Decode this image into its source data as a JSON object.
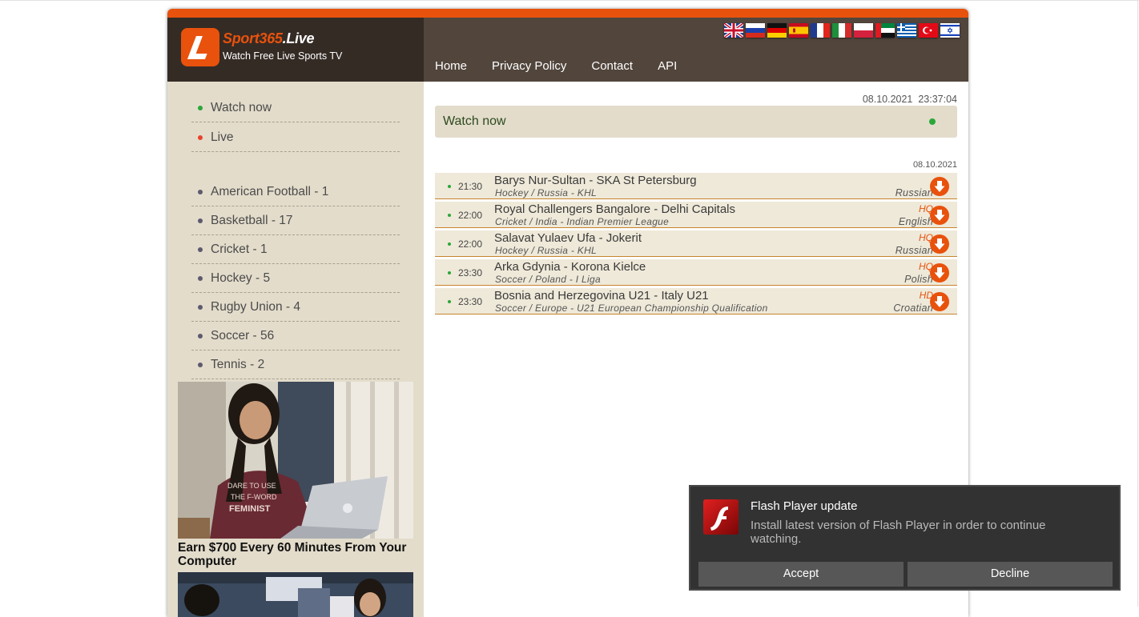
{
  "header": {
    "logo_brand": "Sport365",
    "logo_tld": ".Live",
    "logo_letter": "L",
    "tagline": "Watch Free Live Sports TV",
    "flags": [
      "uk-flag",
      "russia-flag",
      "germany-flag",
      "spain-flag",
      "france-flag",
      "italy-flag",
      "poland-flag",
      "uae-flag",
      "greece-flag",
      "turkey-flag",
      "israel-flag"
    ],
    "nav": [
      "Home",
      "Privacy Policy",
      "Contact",
      "API"
    ]
  },
  "sidebar": {
    "top_items": [
      {
        "label": "Watch now",
        "dot_color": "#2aa73a"
      },
      {
        "label": "Live",
        "dot_color": "#e8432c"
      }
    ],
    "sports": [
      "American Football - 1",
      "Basketball - 17",
      "Cricket - 1",
      "Hockey - 5",
      "Rugby Union - 4",
      "Soccer - 56",
      "Tennis - 2"
    ],
    "sport_dot_color": "#5e5a6e",
    "ad_title": "Earn $700 Every 60 Minutes From Your Computer"
  },
  "main": {
    "datetime": "08.10.2021  23:37:04",
    "watch_now_label": "Watch now",
    "list_date": "08.10.2021",
    "events": [
      {
        "time": "21:30",
        "title": "Barys Nur-Sultan - SKA St Petersburg",
        "category": "Hockey / Russia - KHL",
        "quality": "",
        "language": "Russian"
      },
      {
        "time": "22:00",
        "title": "Royal Challengers Bangalore - Delhi Capitals",
        "category": "Cricket / India - Indian Premier League",
        "quality": "HQ",
        "language": "English"
      },
      {
        "time": "22:00",
        "title": "Salavat Yulaev Ufa - Jokerit",
        "category": "Hockey / Russia - KHL",
        "quality": "HQ",
        "language": "Russian"
      },
      {
        "time": "23:30",
        "title": "Arka Gdynia - Korona Kielce",
        "category": "Soccer / Poland - I Liga",
        "quality": "HQ",
        "language": "Polish"
      },
      {
        "time": "23:30",
        "title": "Bosnia and Herzegovina U21 - Italy U21",
        "category": "Soccer / Europe - U21 European Championship Qualification",
        "quality": "HD",
        "language": "Croatian"
      }
    ]
  },
  "popup": {
    "title": "Flash Player update",
    "message": "Install latest version of Flash Player in order to continue watching.",
    "accept_label": "Accept",
    "decline_label": "Decline"
  },
  "colors": {
    "accent": "#e8520c",
    "header_dark": "#352b25",
    "header_mid": "#51453c",
    "sidebar_bg": "#e3dccb",
    "event_bg": "#efe9d9"
  }
}
